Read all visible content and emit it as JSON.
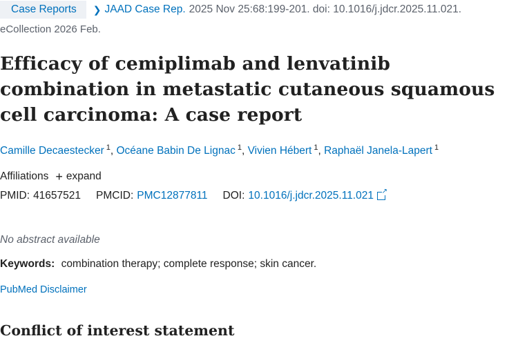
{
  "citation": {
    "article_type": "Case Reports",
    "journal": "JAAD Case Rep.",
    "details": "2025 Nov 25:68:199-201. doi: 10.1016/j.jdcr.2025.11.021.",
    "ecollection": "eCollection 2026 Feb."
  },
  "title": "Efficacy of cemiplimab and lenvatinib combination in metastatic cutaneous squamous cell carcinoma: A case report",
  "authors": [
    {
      "name": "Camille Decaestecker",
      "sup": "1"
    },
    {
      "name": "Océane Babin De Lignac",
      "sup": "1"
    },
    {
      "name": "Vivien Hébert",
      "sup": "1"
    },
    {
      "name": "Raphaël Janela-Lapert",
      "sup": "1"
    }
  ],
  "affiliations": {
    "label": "Affiliations",
    "expand": "expand"
  },
  "ids": {
    "pmid_label": "PMID:",
    "pmid": "41657521",
    "pmcid_label": "PMCID:",
    "pmcid": "PMC12877811",
    "doi_label": "DOI:",
    "doi": "10.1016/j.jdcr.2025.11.021"
  },
  "no_abstract": "No abstract available",
  "keywords": {
    "label": "Keywords:",
    "text": "combination therapy; complete response; skin cancer."
  },
  "disclaimer": "PubMed Disclaimer",
  "conflict_heading": "Conflict of interest statement",
  "colors": {
    "link": "#0071bc",
    "tag_bg": "#eef1f5",
    "muted": "#5b616b",
    "text": "#212121"
  },
  "icons": [
    "chevron-right-icon",
    "plus-icon",
    "external-link-icon"
  ]
}
